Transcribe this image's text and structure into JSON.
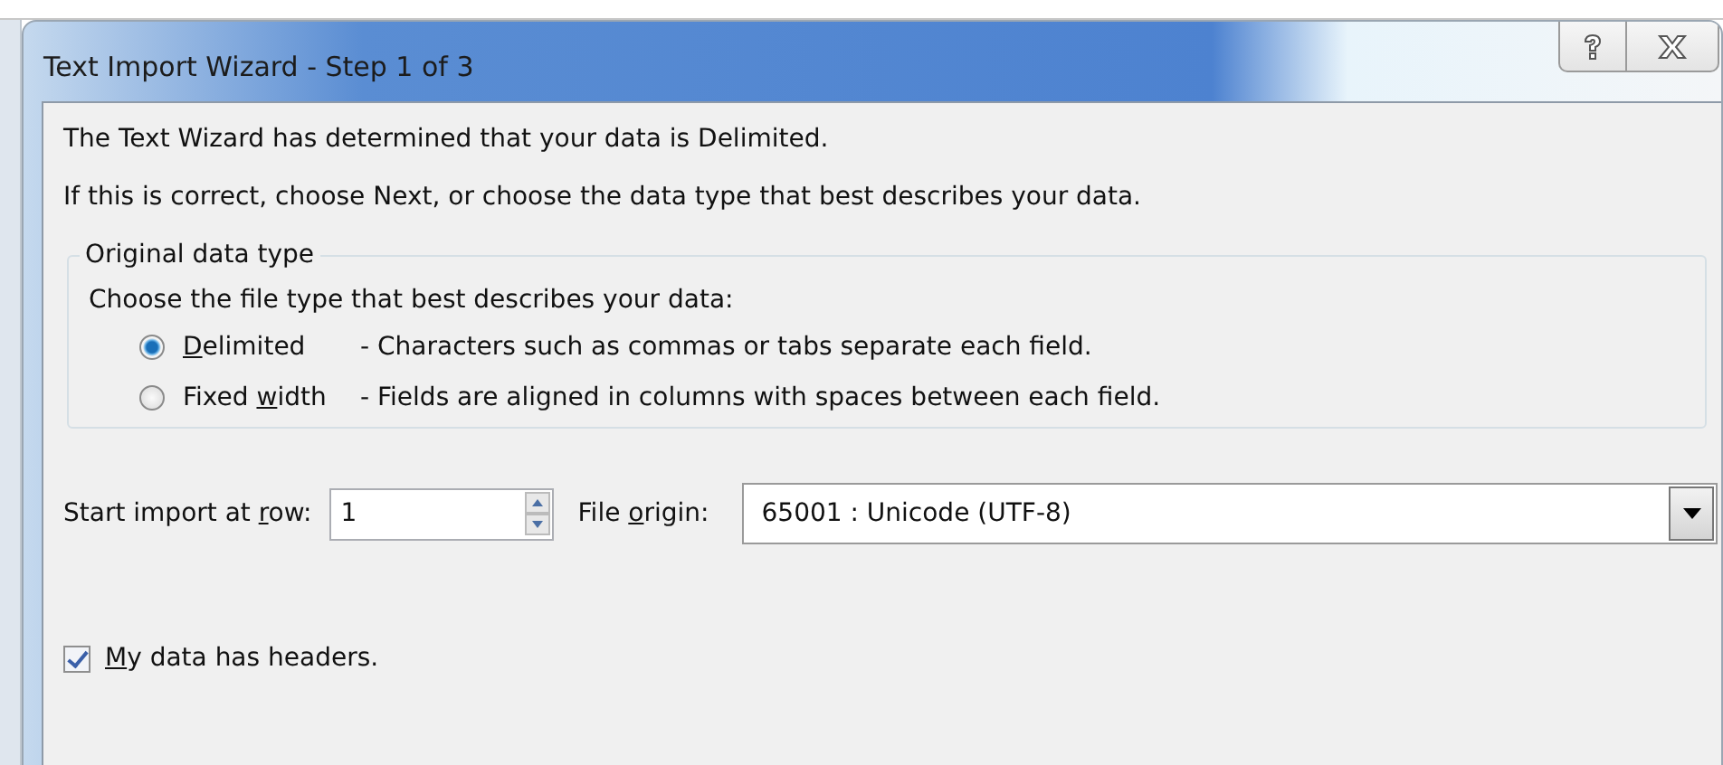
{
  "window": {
    "title": "Text Import Wizard - Step 1 of 3"
  },
  "intro": [
    "The Text Wizard has determined that your data is Delimited.",
    "If this is correct, choose Next, or choose the data type that best describes your data."
  ],
  "original_data_type": {
    "legend": "Original data type",
    "prompt": "Choose the file type that best describes your data:",
    "options": [
      {
        "label_parts": {
          "key": "D",
          "after": "elimited"
        },
        "description": "- Characters such as commas or tabs separate each field.",
        "selected": true
      },
      {
        "label_parts": {
          "before": "Fixed ",
          "key": "w",
          "after": "idth"
        },
        "description": "- Fields are aligned in columns with spaces between each field.",
        "selected": false
      }
    ]
  },
  "start_row": {
    "label_parts": {
      "before": "Start import at ",
      "key": "r",
      "after": "ow:"
    },
    "value": "1"
  },
  "file_origin": {
    "label_parts": {
      "before": "File ",
      "key": "o",
      "after": "rigin:"
    },
    "value": "65001 : Unicode (UTF-8)"
  },
  "headers": {
    "label_parts": {
      "key": "M",
      "after": "y data has headers."
    },
    "checked": true
  }
}
